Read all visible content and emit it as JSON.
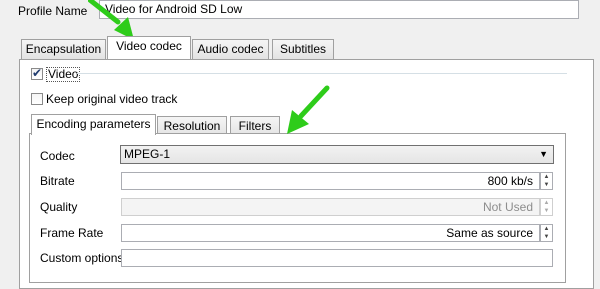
{
  "profile": {
    "label": "Profile Name",
    "value": "Video for Android SD Low"
  },
  "top_tabs": [
    "Encapsulation",
    "Video codec",
    "Audio codec",
    "Subtitles"
  ],
  "video_checkbox": {
    "label": "Video",
    "checked": true
  },
  "keep_checkbox": {
    "label": "Keep original video track",
    "checked": false
  },
  "inner_tabs": [
    "Encoding parameters",
    "Resolution",
    "Filters"
  ],
  "fields": {
    "codec": {
      "label": "Codec",
      "value": "MPEG-1"
    },
    "bitrate": {
      "label": "Bitrate",
      "value": "800 kb/s"
    },
    "quality": {
      "label": "Quality",
      "value": "Not Used"
    },
    "frame_rate": {
      "label": "Frame Rate",
      "value": "Same as source"
    },
    "custom_options": {
      "label": "Custom options",
      "value": ""
    }
  },
  "annotation_color": "#2ecc1a"
}
